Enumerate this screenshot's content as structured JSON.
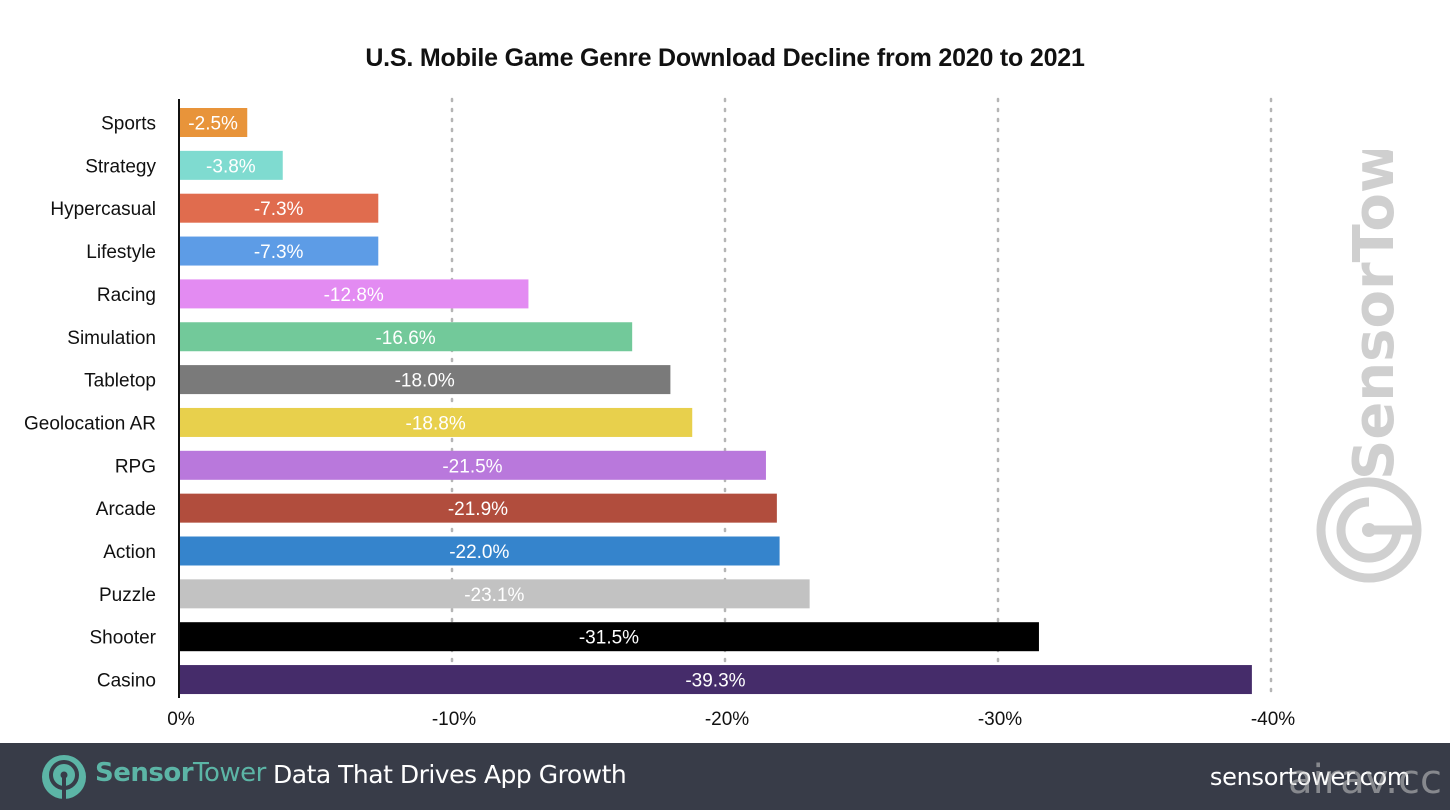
{
  "chart_data": {
    "type": "bar",
    "orientation": "horizontal",
    "title": "U.S. Mobile Game Genre Download Decline from 2020 to 2021",
    "xlabel": "",
    "ylabel": "",
    "xlim": [
      0,
      -40
    ],
    "x_ticks": [
      0,
      -10,
      -20,
      -30,
      -40
    ],
    "x_tick_labels": [
      "0%",
      "-10%",
      "-20%",
      "-30%",
      "-40%"
    ],
    "grid": "vertical dotted",
    "categories": [
      "Sports",
      "Strategy",
      "Hypercasual",
      "Lifestyle",
      "Racing",
      "Simulation",
      "Tabletop",
      "Geolocation AR",
      "RPG",
      "Arcade",
      "Action",
      "Puzzle",
      "Shooter",
      "Casino"
    ],
    "values": [
      -2.5,
      -3.8,
      -7.3,
      -7.3,
      -12.8,
      -16.6,
      -18.0,
      -18.8,
      -21.5,
      -21.9,
      -22.0,
      -23.1,
      -31.5,
      -39.3
    ],
    "value_labels": [
      "-2.5%",
      "-3.8%",
      "-7.3%",
      "-7.3%",
      "-12.8%",
      "-16.6%",
      "-18.0%",
      "-18.8%",
      "-21.5%",
      "-21.9%",
      "-22.0%",
      "-23.1%",
      "-31.5%",
      "-39.3%"
    ],
    "colors": [
      "#e8943a",
      "#7fdbd0",
      "#e06c4e",
      "#5d9ce6",
      "#e38bf2",
      "#72c99a",
      "#7a7a7a",
      "#e8d04c",
      "#b978dc",
      "#b14d3d",
      "#3584cc",
      "#c2c2c2",
      "#000000",
      "#452c6a"
    ]
  },
  "watermark": {
    "text": "SensorTower",
    "icon": "sensortower-logo-icon"
  },
  "footer": {
    "brand_bold": "Sensor",
    "brand_light": "Tower",
    "tagline": "Data That Drives App Growth",
    "url": "sensortower.com",
    "corner_mark": "airav.cc",
    "brand_color": "#5cb5a6",
    "background": "#383c48"
  }
}
